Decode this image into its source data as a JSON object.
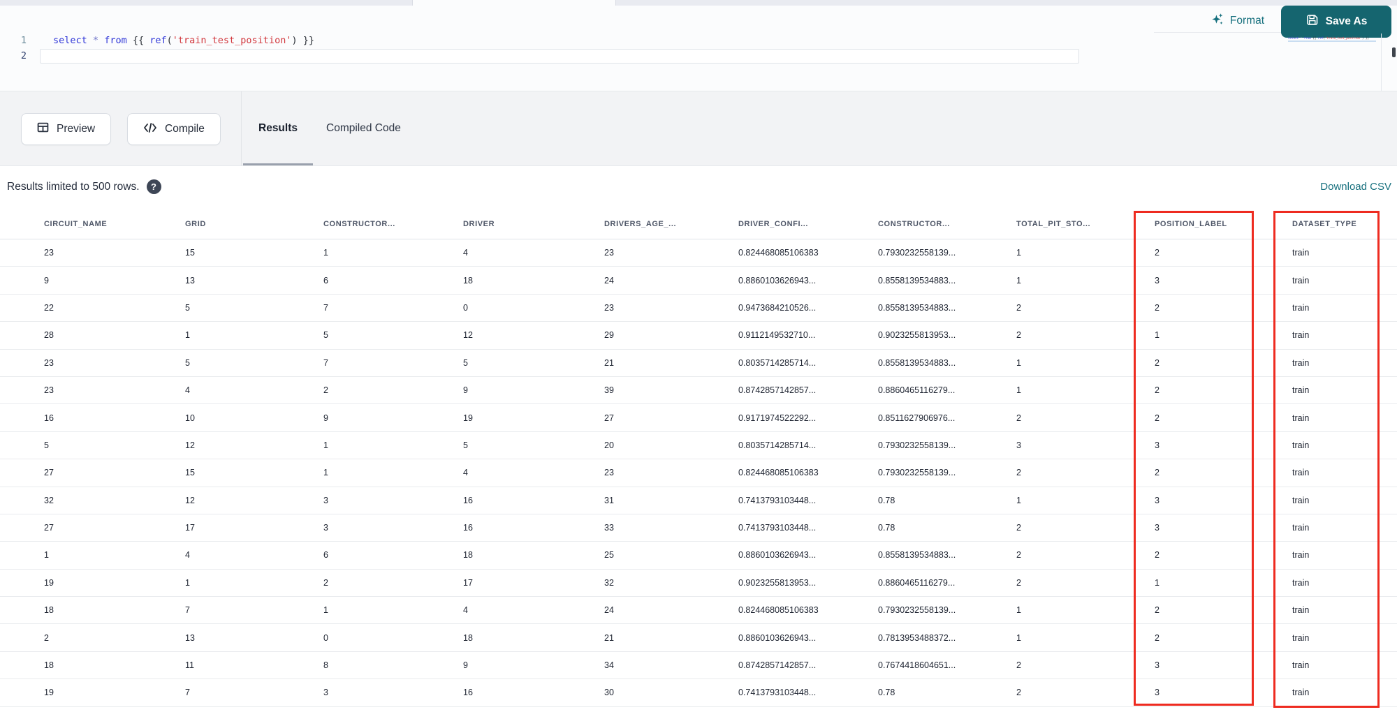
{
  "editor": {
    "line_numbers": [
      "1",
      "2"
    ],
    "code_text": "select * from {{ ref('train_test_position') }}",
    "code_tokens": [
      {
        "text": "select",
        "type": "kw"
      },
      {
        "text": " ",
        "type": "plain"
      },
      {
        "text": "*",
        "type": "op"
      },
      {
        "text": " ",
        "type": "plain"
      },
      {
        "text": "from",
        "type": "kw"
      },
      {
        "text": " {{ ",
        "type": "punc"
      },
      {
        "text": "ref",
        "type": "fn"
      },
      {
        "text": "(",
        "type": "punc"
      },
      {
        "text": "'train_test_position'",
        "type": "str"
      },
      {
        "text": ")",
        "type": "punc"
      },
      {
        "text": " }}",
        "type": "punc"
      }
    ]
  },
  "header_actions": {
    "format_label": "Format",
    "save_as_label": "Save As"
  },
  "toolbar": {
    "preview_label": "Preview",
    "compile_label": "Compile",
    "tabs": [
      {
        "label": "Results",
        "active": true
      },
      {
        "label": "Compiled Code",
        "active": false
      }
    ]
  },
  "results_bar": {
    "info_text": "Results limited to 500 rows.",
    "help_icon": "?",
    "download_label": "Download CSV"
  },
  "table": {
    "columns": [
      "CIRCUIT_NAME",
      "GRID",
      "CONSTRUCTOR...",
      "DRIVER",
      "DRIVERS_AGE_...",
      "DRIVER_CONFI...",
      "CONSTRUCTOR...",
      "TOTAL_PIT_STO...",
      "POSITION_LABEL",
      "DATASET_TYPE"
    ],
    "rows": [
      [
        "23",
        "15",
        "1",
        "4",
        "23",
        "0.824468085106383",
        "0.7930232558139...",
        "1",
        "2",
        "train"
      ],
      [
        "9",
        "13",
        "6",
        "18",
        "24",
        "0.8860103626943...",
        "0.8558139534883...",
        "1",
        "3",
        "train"
      ],
      [
        "22",
        "5",
        "7",
        "0",
        "23",
        "0.9473684210526...",
        "0.8558139534883...",
        "2",
        "2",
        "train"
      ],
      [
        "28",
        "1",
        "5",
        "12",
        "29",
        "0.9112149532710...",
        "0.9023255813953...",
        "2",
        "1",
        "train"
      ],
      [
        "23",
        "5",
        "7",
        "5",
        "21",
        "0.8035714285714...",
        "0.8558139534883...",
        "1",
        "2",
        "train"
      ],
      [
        "23",
        "4",
        "2",
        "9",
        "39",
        "0.8742857142857...",
        "0.8860465116279...",
        "1",
        "2",
        "train"
      ],
      [
        "16",
        "10",
        "9",
        "19",
        "27",
        "0.9171974522292...",
        "0.8511627906976...",
        "2",
        "2",
        "train"
      ],
      [
        "5",
        "12",
        "1",
        "5",
        "20",
        "0.8035714285714...",
        "0.7930232558139...",
        "3",
        "3",
        "train"
      ],
      [
        "27",
        "15",
        "1",
        "4",
        "23",
        "0.824468085106383",
        "0.7930232558139...",
        "2",
        "2",
        "train"
      ],
      [
        "32",
        "12",
        "3",
        "16",
        "31",
        "0.7413793103448...",
        "0.78",
        "1",
        "3",
        "train"
      ],
      [
        "27",
        "17",
        "3",
        "16",
        "33",
        "0.7413793103448...",
        "0.78",
        "2",
        "3",
        "train"
      ],
      [
        "1",
        "4",
        "6",
        "18",
        "25",
        "0.8860103626943...",
        "0.8558139534883...",
        "2",
        "2",
        "train"
      ],
      [
        "19",
        "1",
        "2",
        "17",
        "32",
        "0.9023255813953...",
        "0.8860465116279...",
        "2",
        "1",
        "train"
      ],
      [
        "18",
        "7",
        "1",
        "4",
        "24",
        "0.824468085106383",
        "0.7930232558139...",
        "1",
        "2",
        "train"
      ],
      [
        "2",
        "13",
        "0",
        "18",
        "21",
        "0.8860103626943...",
        "0.7813953488372...",
        "1",
        "2",
        "train"
      ],
      [
        "18",
        "11",
        "8",
        "9",
        "34",
        "0.8742857142857...",
        "0.7674418604651...",
        "2",
        "3",
        "train"
      ],
      [
        "19",
        "7",
        "3",
        "16",
        "30",
        "0.7413793103448...",
        "0.78",
        "2",
        "3",
        "train"
      ]
    ]
  },
  "annotations": {
    "highlight_color": "#ee2b20",
    "highlighted_columns": [
      "POSITION_LABEL",
      "DATASET_TYPE"
    ]
  },
  "colors": {
    "accent_teal": "#15656f",
    "link_teal": "#17707e",
    "keyword_blue": "#2f36d8",
    "string_red": "#d2373d",
    "header_text": "#4d5566",
    "cell_text": "#202633",
    "row_border": "#e9ebee",
    "toolbar_bg": "#f2f3f5"
  }
}
